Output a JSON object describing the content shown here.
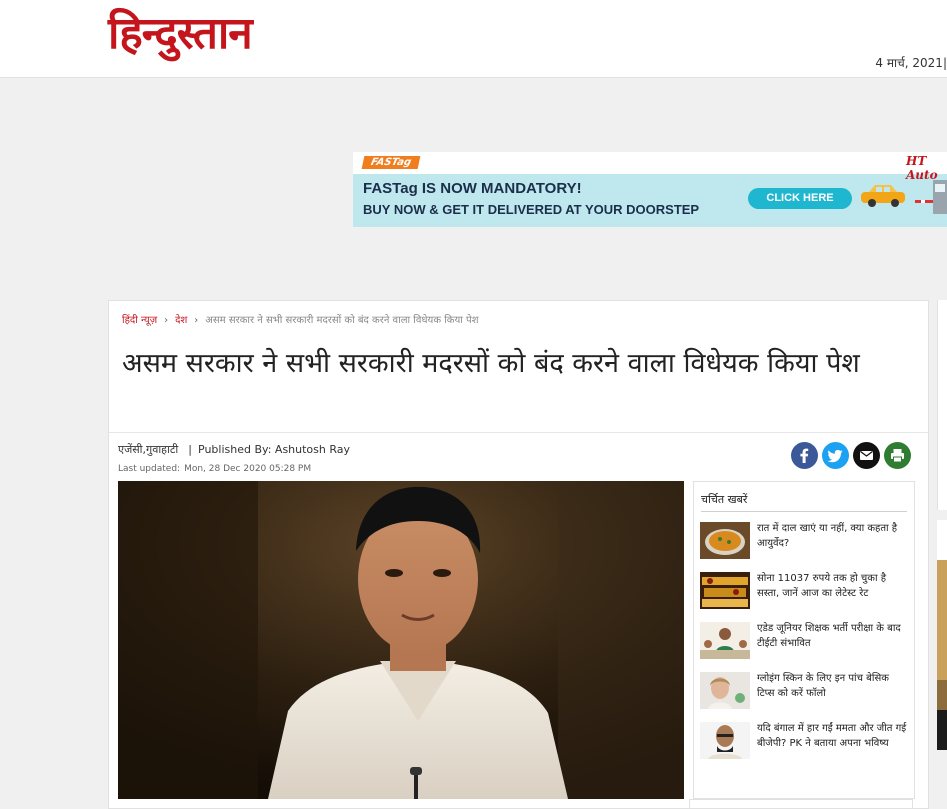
{
  "header": {
    "logo_text": "हिन्दुस्तान",
    "date": "4 मार्च, 2021|"
  },
  "ad": {
    "brand": "FASTag",
    "publisher": "HT Auto",
    "headline": "FASTag IS NOW MANDATORY!",
    "subline": "BUY NOW & GET IT DELIVERED AT YOUR DOORSTEP",
    "cta": "CLICK HERE"
  },
  "breadcrumb": {
    "items": [
      "हिंदी न्यूज़",
      "देश"
    ],
    "current": "असम सरकार ने सभी सरकारी मदरसों को बंद करने वाला विधेयक किया पेश",
    "separator": "›"
  },
  "article": {
    "title": "असम सरकार ने सभी सरकारी मदरसों को बंद करने वाला विधेयक किया पेश",
    "source": "एजेंसी,गुवाहाटी",
    "published_by": "Published By: Ashutosh Ray",
    "updated_label": "Last updated:",
    "updated_value": "Mon, 28 Dec 2020 05:28 PM"
  },
  "share_icons": [
    "facebook-icon",
    "twitter-icon",
    "email-icon",
    "print-icon"
  ],
  "trending": {
    "heading": "चर्चित खबरें",
    "items": [
      {
        "text": "रात में दाल खाएं या नहीं, क्या कहता है आयुर्वेद?"
      },
      {
        "text": "सोना 11037 रुपये तक हो चुका है सस्ता, जानें आज का लेटेस्ट रेट"
      },
      {
        "text": "एडेड जूनियर शिक्षक भर्ती परीक्षा के बाद टीईटी संभावित"
      },
      {
        "text": "ग्लोइंग स्किन के लिए इन पांच बेसिक टिप्स को करें फॉलो"
      },
      {
        "text": "यदि बंगाल में हार गईं ममता और जीत गई बीजेपी? PK ने बताया अपना भविष्य"
      }
    ]
  },
  "colors": {
    "brand_red": "#c4151c",
    "facebook": "#3b5998",
    "twitter": "#1da1f2",
    "email": "#111111",
    "print": "#2e7d32",
    "ad_bg": "#bfe8ee"
  }
}
